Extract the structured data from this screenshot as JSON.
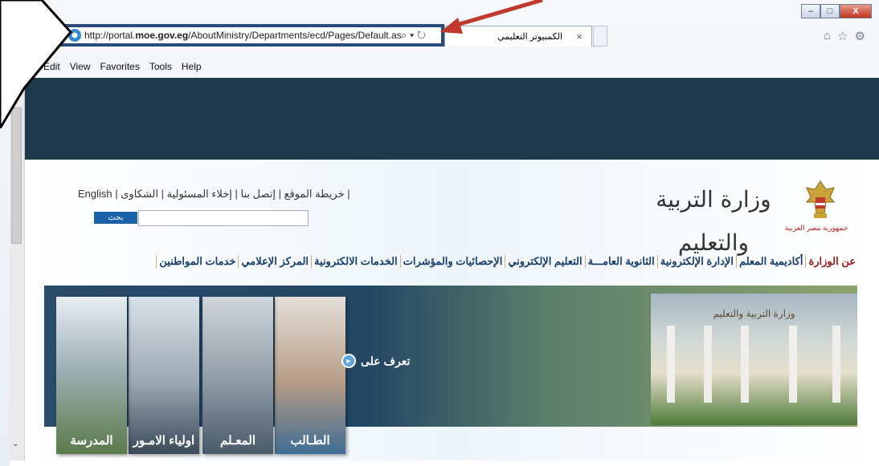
{
  "browser": {
    "url_prefix": "http://portal.",
    "url_domain": "moe.gov.eg",
    "url_path": "/AboutMinistry/Departments/ecd/Pages/Default.aspx",
    "addr_controls": "⌕ ▾ ↻",
    "tab_title": "الكمبيوتر التعليمي",
    "tab_close": "×",
    "menu": [
      "Edit",
      "View",
      "Favorites",
      "Tools",
      "Help"
    ],
    "window_controls": {
      "minimize": "–",
      "maximize": "□",
      "close": "X"
    },
    "toolbar_icons": [
      "home-icon",
      "star-icon",
      "gear-icon"
    ]
  },
  "site": {
    "top_links": "| خريطة الموقع | إتصل بنا | إخلاء المسئولية | الشكاوى | English",
    "search_button": "بحث",
    "ministry_name": "وزارة التربية والتعليم",
    "republic_label": "جمهورية مصر العربية",
    "nav": [
      "عن الوزارة",
      "أكاديمية المعلم",
      "الإدارة الإلكترونية",
      "الثانوية العامـــة",
      "التعليم الإلكتروني",
      "الإحصائيات والمؤشرات",
      "الخدمات الالكترونية",
      "المركز الإعلامي",
      "خدمات المواطنين"
    ],
    "banner": {
      "learn_label": "تعرف على",
      "books": [
        "الطـالب",
        "المعـلم",
        "اولياء الامـور",
        "المدرسة"
      ],
      "building_sign": "وزارة التربية والتعليم"
    }
  },
  "colors": {
    "dark_band": "#1f3a4a",
    "address_highlight": "#2a4a7c",
    "annotation_arrow": "#c0392b",
    "nav_text": "#163e6b",
    "nav_first": "#9a1a1a"
  }
}
